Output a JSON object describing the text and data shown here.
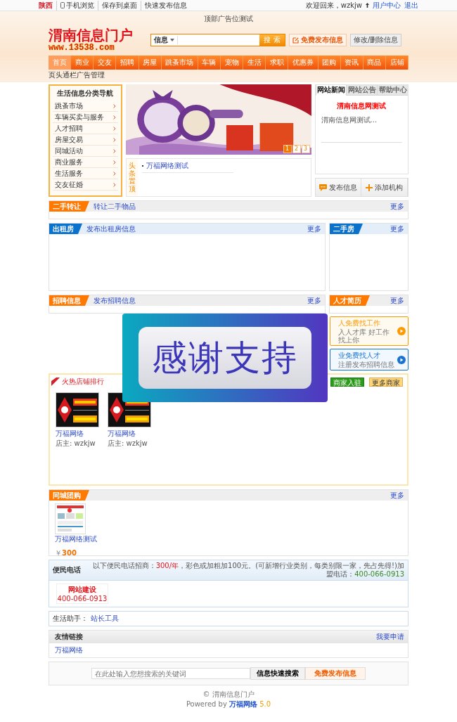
{
  "top_bar": {
    "region": "陕西",
    "links": [
      "手机浏览",
      "保存到桌面",
      "快速发布信息"
    ],
    "welcome": "欢迎回来，wzkjw",
    "user_links": [
      "用户中心",
      "退出"
    ]
  },
  "header": {
    "ad_text": "顶部广告位测试",
    "logo_title": "渭南信息门户",
    "logo_url": "www.13538.com",
    "search_category": "信息",
    "search_button": "搜 索",
    "post_button": "免费发布信息",
    "edit_button": "修改/删除信息"
  },
  "nav": [
    {
      "label": "首页",
      "selected": true
    },
    {
      "label": "商业",
      "selected": false
    },
    {
      "label": "交友",
      "selected": false
    },
    {
      "label": "招聘",
      "selected": false
    },
    {
      "label": "房屋",
      "selected": false
    },
    {
      "label": "跳蚤市场",
      "selected": false
    },
    {
      "label": "车辆",
      "selected": false
    },
    {
      "label": "宠物",
      "selected": false
    },
    {
      "label": "生活",
      "selected": false
    },
    {
      "label": "求职",
      "selected": false
    },
    {
      "label": "优惠券",
      "selected": false
    },
    {
      "label": "团购",
      "selected": false
    },
    {
      "label": "资讯",
      "selected": false
    },
    {
      "label": "商品",
      "selected": false
    },
    {
      "label": "店铺",
      "selected": false
    }
  ],
  "ad_notice": "页头通栏广告管理",
  "category_nav": {
    "title": "生活信息分类导航",
    "items": [
      "跳蚤市场",
      "车辆买卖与服务",
      "人才招聘",
      "房屋交易",
      "同城活动",
      "商业服务",
      "生活服务",
      "交友征婚"
    ]
  },
  "slider_pages": [
    {
      "label": "1",
      "selected": true
    },
    {
      "label": "2",
      "selected": false
    },
    {
      "label": "3",
      "selected": false
    }
  ],
  "headlines": {
    "label": "头条置顶",
    "items": [
      "万福网络测试"
    ]
  },
  "news_panel": {
    "tabs": [
      {
        "label": "网站新闻",
        "selected": true
      },
      {
        "label": "网站公告",
        "selected": false
      },
      {
        "label": "帮助中心",
        "selected": false
      }
    ],
    "title": "渭南信息网测试",
    "summary": "渭南信息网测试..."
  },
  "actions": [
    {
      "label": "发布信息",
      "kind": "message"
    },
    {
      "label": "添加机构",
      "kind": "add"
    }
  ],
  "section_rows": [
    [
      {
        "title": "二手转让",
        "link": "转让二手物品",
        "more": "更多",
        "color": "#ff7800"
      }
    ],
    [
      {
        "title": "出租房",
        "link": "发布出租房信息",
        "more": "更多",
        "color": "#0a72cc"
      },
      {
        "title": "二手房",
        "more": "更多",
        "color": "#0a72cc"
      }
    ],
    [
      {
        "title": "招聘信息",
        "link": "发布招聘信息",
        "more": "更多",
        "color": "#ff7800"
      },
      {
        "title": "人才简历",
        "more": "更多",
        "color": "#ff7800"
      }
    ]
  ],
  "job_promos": [
    {
      "title": "人免费找工作",
      "text": "入人才库  好工作找上你",
      "color": "#ff9900"
    },
    {
      "title": "业免费找人才",
      "text": "注册发布招聘信息",
      "color": "#1a73d0"
    }
  ],
  "popup": {
    "text": "感谢支持"
  },
  "shops": {
    "title": "火热店铺排行",
    "join_button": "商家入驻",
    "more_button": "更多商家",
    "items": [
      {
        "name": "万福网络",
        "owner": "店主: wzkjw"
      },
      {
        "name": "万福网络",
        "owner": "店主: wzkjw"
      }
    ]
  },
  "group_buy": {
    "title": "同城团购",
    "more": "更多",
    "color": "#ff7800",
    "items": [
      {
        "name": "万福网络测试",
        "currency": "￥",
        "price": "300"
      }
    ]
  },
  "phones": {
    "title": "便民电话",
    "notice_start": "以下便民电话招商：",
    "fee": "300/年",
    "notice_end": "，彩色或加粗加100元。(可新增行业类别，每类别限一家，先占先得!)加盟电话：",
    "hotline": "400-066-0913",
    "cards": [
      {
        "name": "网站建设",
        "phone": "400-066-0913"
      }
    ]
  },
  "assistant": {
    "label": "生活助手：",
    "links": [
      "站长工具"
    ]
  },
  "friend_links": {
    "title": "友情链接",
    "apply": "我要申请",
    "links": [
      "万福网络"
    ]
  },
  "bottom_search": {
    "placeholder": "在此处输入您想搜索的关键词",
    "search_button": "信息快速搜索",
    "post_button": "免费发布信息"
  },
  "footer": {
    "copyright": "© 渭南信息门户",
    "powered_prefix": "Powered by",
    "powered_brand": "万福网络",
    "version": "5.0"
  }
}
